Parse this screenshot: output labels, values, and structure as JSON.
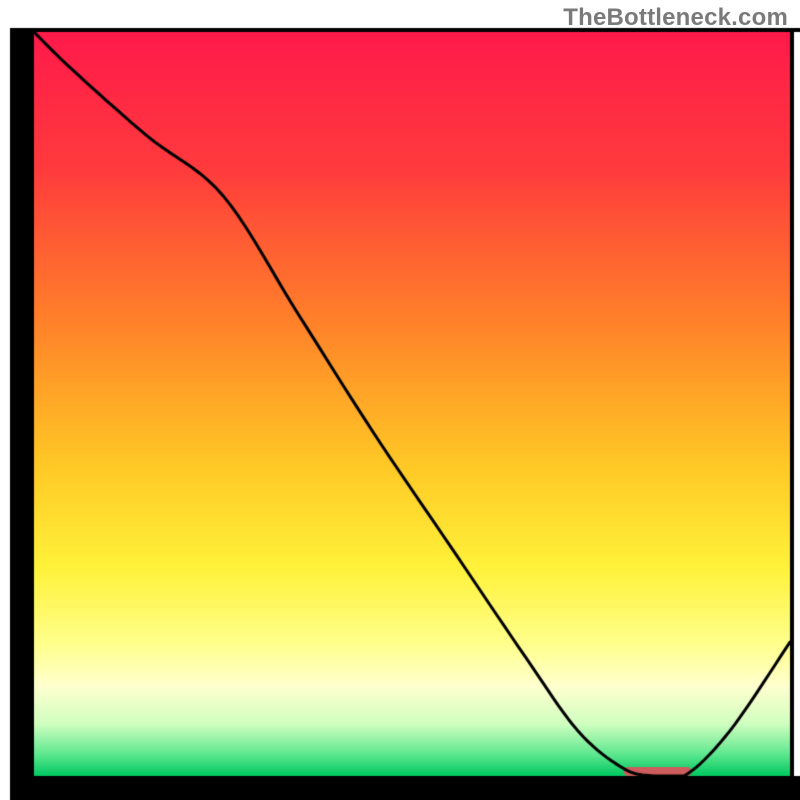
{
  "watermark": "TheBottleneck.com",
  "colors": {
    "border": "#000000",
    "curve": "#000000",
    "marker": "#cd5c5c",
    "gradient_stops": [
      {
        "offset": 0.0,
        "color": "#ff1a4b"
      },
      {
        "offset": 0.18,
        "color": "#ff3a3d"
      },
      {
        "offset": 0.38,
        "color": "#ff7e2a"
      },
      {
        "offset": 0.58,
        "color": "#ffc825"
      },
      {
        "offset": 0.72,
        "color": "#fff23a"
      },
      {
        "offset": 0.82,
        "color": "#ffff8a"
      },
      {
        "offset": 0.88,
        "color": "#ffffd0"
      },
      {
        "offset": 0.93,
        "color": "#d0ffc0"
      },
      {
        "offset": 0.97,
        "color": "#60e890"
      },
      {
        "offset": 1.0,
        "color": "#00c860"
      }
    ]
  },
  "chart_data": {
    "type": "line",
    "title": "",
    "xlabel": "",
    "ylabel": "",
    "xlim": [
      0,
      100
    ],
    "ylim": [
      0,
      100
    ],
    "series": [
      {
        "name": "bottleneck-curve",
        "x": [
          0,
          5,
          15,
          25,
          35,
          45,
          55,
          65,
          72,
          78,
          82,
          86,
          92,
          100
        ],
        "y": [
          100,
          95,
          86,
          78,
          62,
          46,
          31,
          16,
          6,
          1,
          0,
          0,
          6,
          18
        ]
      }
    ],
    "marker": {
      "name": "optimal-range",
      "x_start": 78,
      "x_end": 87,
      "y": 0.6,
      "height": 1.2
    }
  }
}
